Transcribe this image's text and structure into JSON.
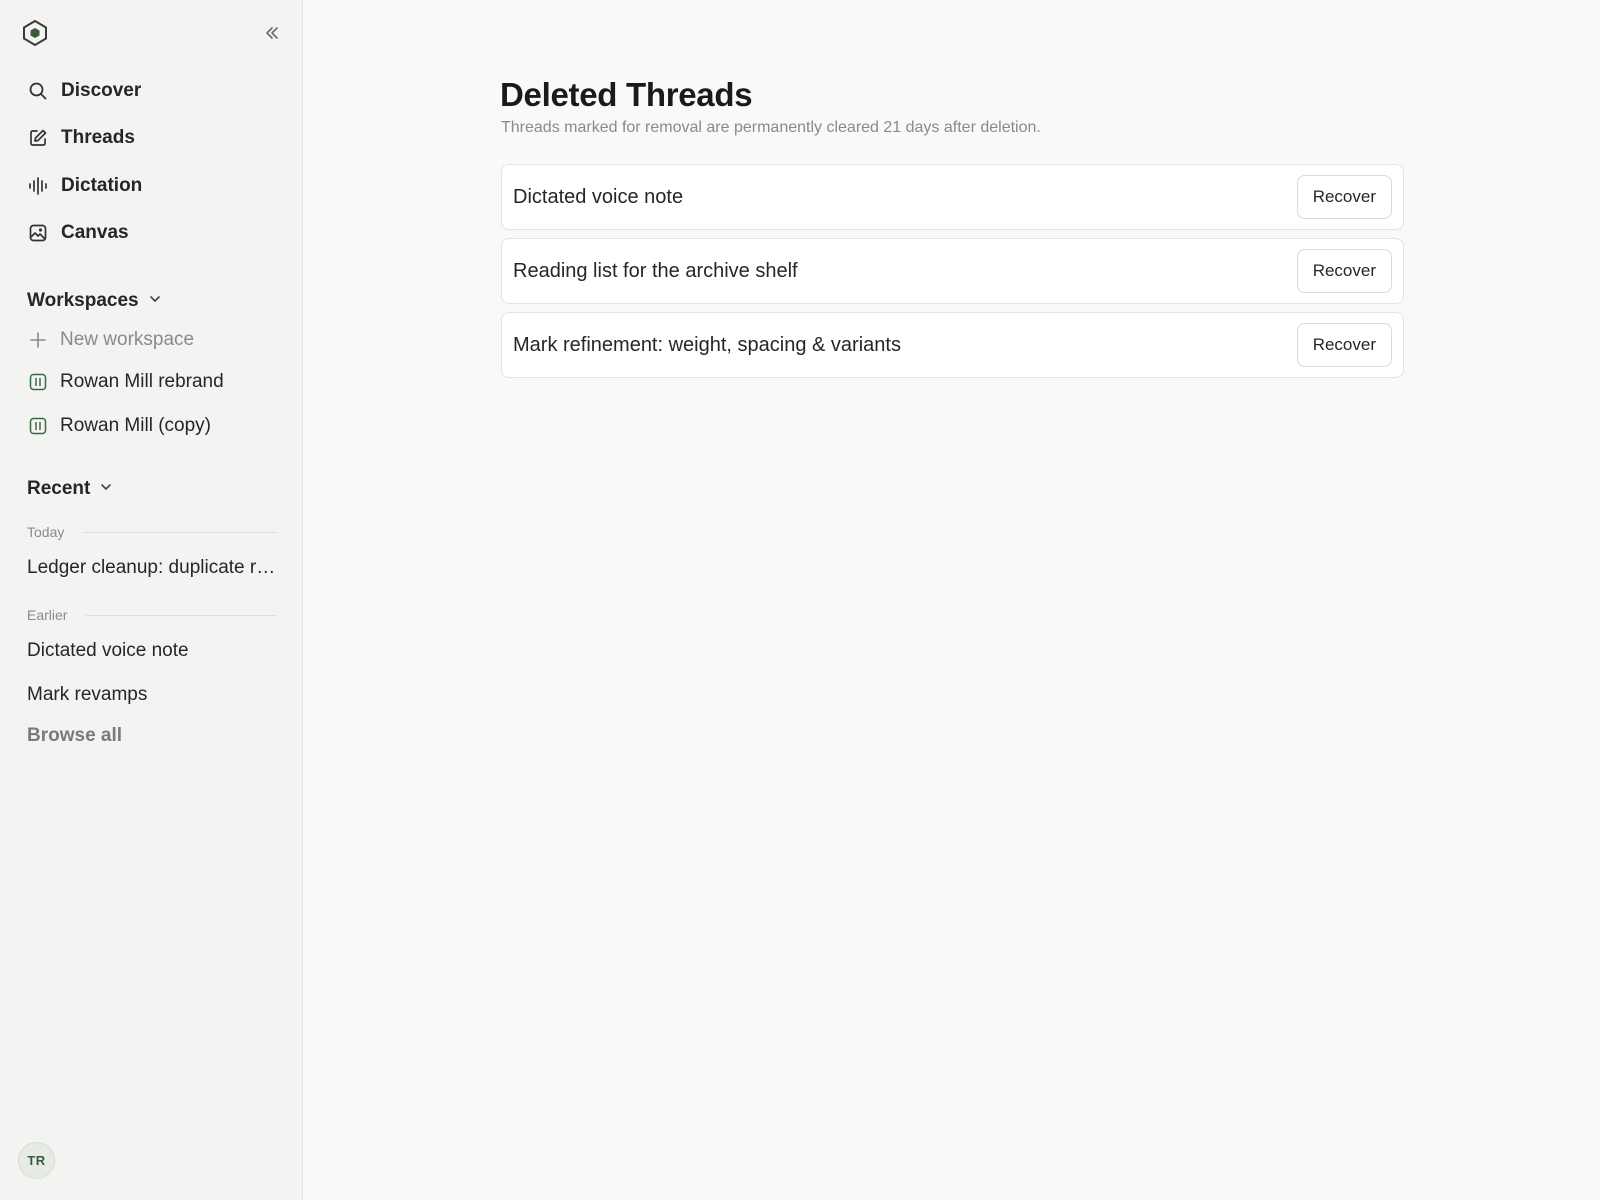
{
  "sidebar": {
    "nav": [
      {
        "label": "Discover",
        "icon": "search-icon"
      },
      {
        "label": "Threads",
        "icon": "compose-icon"
      },
      {
        "label": "Dictation",
        "icon": "waveform-icon"
      },
      {
        "label": "Canvas",
        "icon": "canvas-icon"
      }
    ],
    "workspaces": {
      "label": "Workspaces",
      "new_label": "New workspace",
      "items": [
        {
          "label": "Rowan Mill rebrand",
          "icon": "workspace-icon"
        },
        {
          "label": "Rowan Mill (copy)",
          "icon": "workspace-icon"
        }
      ]
    },
    "recent": {
      "label": "Recent",
      "today_label": "Today",
      "today_items": [
        "Ledger cleanup: duplicate rows"
      ],
      "earlier_label": "Earlier",
      "earlier_items": [
        "Dictated voice note",
        "Mark revamps"
      ],
      "browse_all": "Browse all"
    },
    "avatar_initials": "TR"
  },
  "main": {
    "title": "Deleted Threads",
    "subtitle": "Threads marked for removal are permanently cleared 21 days after deletion.",
    "threads": [
      {
        "title": "Dictated voice note",
        "action": "Recover"
      },
      {
        "title": "Reading list for the archive shelf",
        "action": "Recover"
      },
      {
        "title": "Mark refinement: weight, spacing & variants",
        "action": "Recover"
      }
    ]
  },
  "colors": {
    "accent": "#3a5a3c",
    "sidebar_bg": "#f3f3f2",
    "page_bg": "#f9f9f8"
  }
}
